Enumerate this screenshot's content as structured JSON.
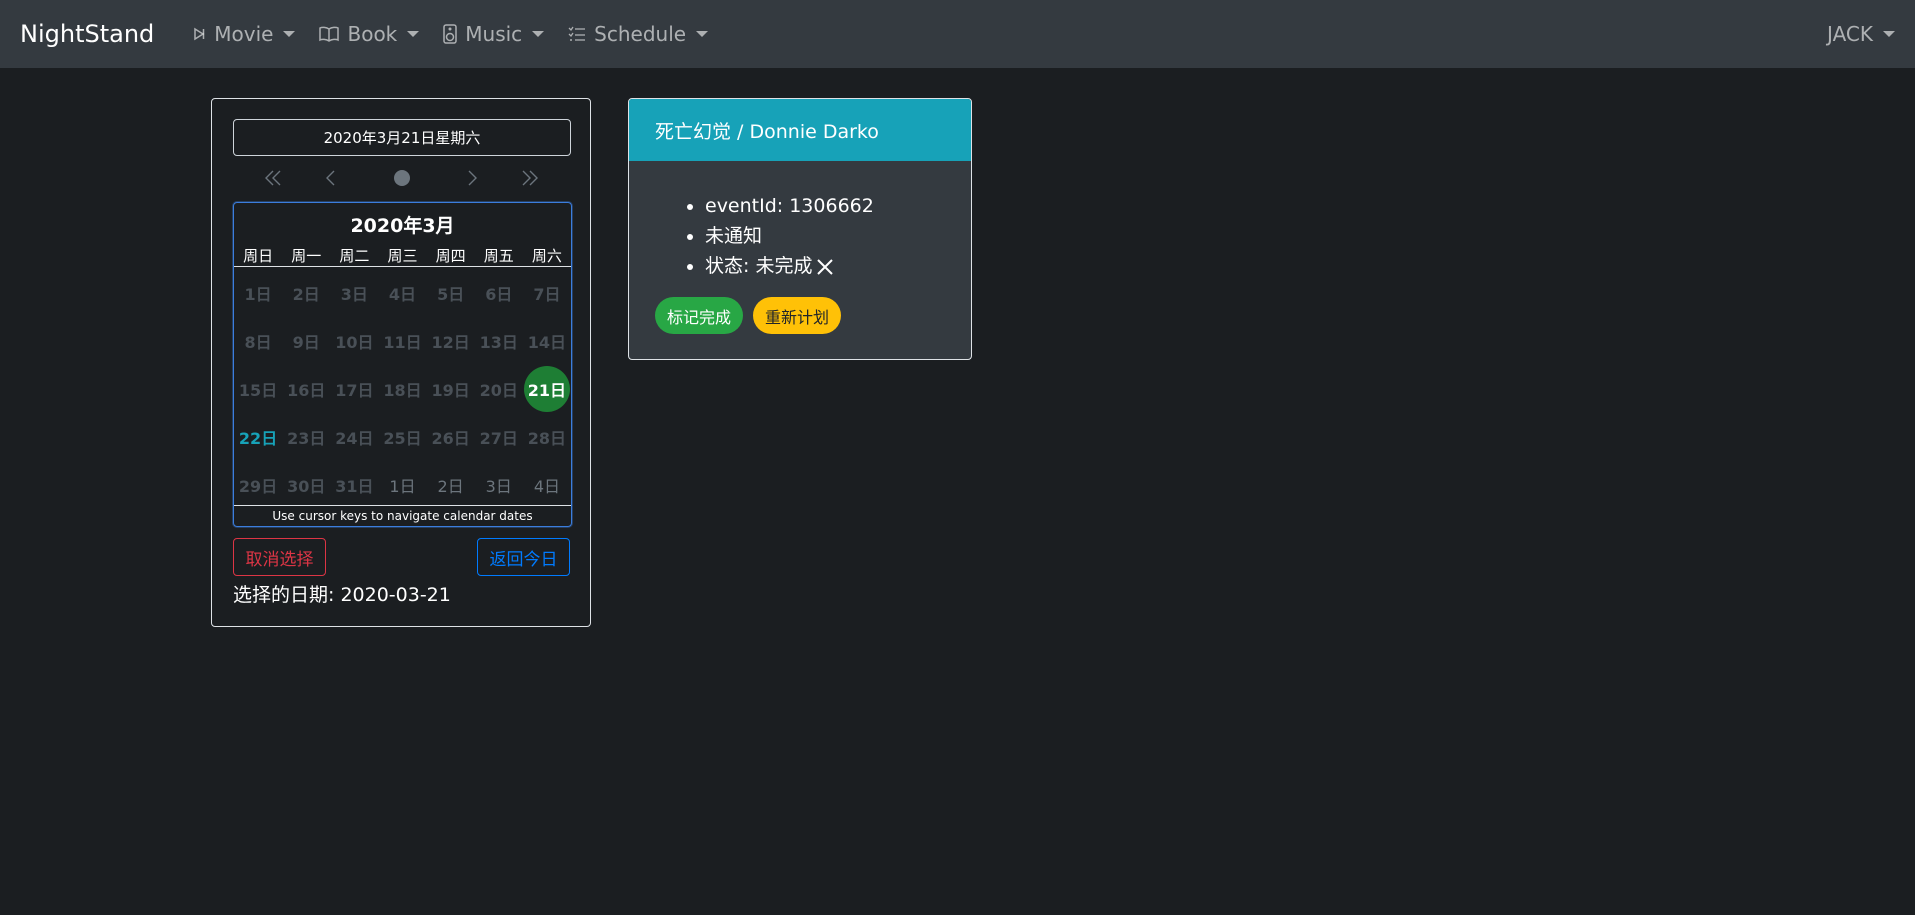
{
  "navbar": {
    "brand": "NightStand",
    "items": [
      {
        "label": "Movie",
        "icon": "play-icon"
      },
      {
        "label": "Book",
        "icon": "book-icon"
      },
      {
        "label": "Music",
        "icon": "speaker-icon"
      },
      {
        "label": "Schedule",
        "icon": "list-icon"
      }
    ],
    "user": "JACK"
  },
  "calendar": {
    "date_output": "2020年3月21日星期六",
    "month_title": "2020年3月",
    "weekdays": [
      "周日",
      "周一",
      "周二",
      "周三",
      "周四",
      "周五",
      "周六"
    ],
    "weeks": [
      [
        "1日",
        "2日",
        "3日",
        "4日",
        "5日",
        "6日",
        "7日"
      ],
      [
        "8日",
        "9日",
        "10日",
        "11日",
        "12日",
        "13日",
        "14日"
      ],
      [
        "15日",
        "16日",
        "17日",
        "18日",
        "19日",
        "20日",
        "21日"
      ],
      [
        "22日",
        "23日",
        "24日",
        "25日",
        "26日",
        "27日",
        "28日"
      ],
      [
        "29日",
        "30日",
        "31日",
        "1日",
        "2日",
        "3日",
        "4日"
      ]
    ],
    "hint": "Use cursor keys to navigate calendar dates",
    "cancel_label": "取消选择",
    "today_label": "返回今日",
    "selected_text": "选择的日期: 2020-03-21"
  },
  "event": {
    "title": "死亡幻觉 / Donnie Darko",
    "details": [
      "eventId: 1306662",
      "未通知",
      "状态: 未完成"
    ],
    "status_icon": "x-icon",
    "complete_label": "标记完成",
    "reschedule_label": "重新计划"
  },
  "colors": {
    "navbar_bg": "#343a40",
    "page_bg": "#1b1e21",
    "card_header": "#17a2b8",
    "selected_day": "#1e7e34",
    "today_text": "#17a2b8",
    "success": "#28a745",
    "warning": "#ffc107",
    "danger": "#dc3545",
    "primary": "#007bff"
  }
}
